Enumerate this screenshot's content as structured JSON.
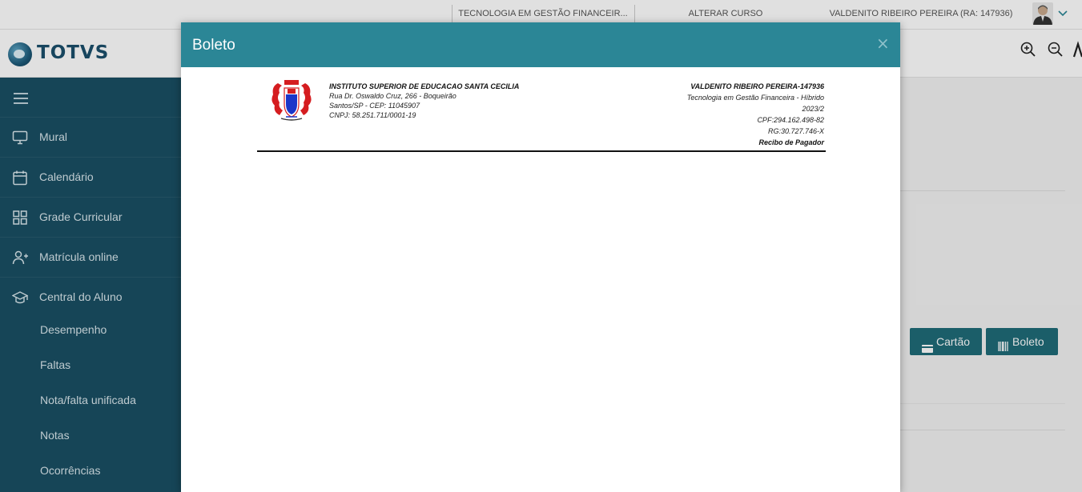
{
  "topbar": {
    "course": "TECNOLOGIA EM GESTÃO FINANCEIR...",
    "change_course": "ALTERAR CURSO",
    "user": "VALDENITO RIBEIRO PEREIRA (RA: 147936)"
  },
  "brand": {
    "logo_text": "TOTVS"
  },
  "sidebar": {
    "items": [
      {
        "label": "Mural",
        "icon": "monitor-icon"
      },
      {
        "label": "Calendário",
        "icon": "calendar-icon"
      },
      {
        "label": "Grade Curricular",
        "icon": "grid-icon"
      },
      {
        "label": "Matrícula online",
        "icon": "user-plus-icon"
      },
      {
        "label": "Central do Aluno",
        "icon": "graduation-cap-icon"
      }
    ],
    "subitems": [
      "Desempenho",
      "Faltas",
      "Nota/falta unificada",
      "Notas",
      "Ocorrências"
    ]
  },
  "background": {
    "card_button": "Cartão",
    "boleto_button": "Boleto"
  },
  "modal": {
    "title": "Boleto",
    "close": "×",
    "institution": {
      "name": "INSTITUTO SUPERIOR  DE EDUCACAO SANTA CECILIA",
      "address": "Rua Dr. Oswaldo Cruz, 266 - Boqueirão",
      "city": "Santos/SP - CEP: 11045907",
      "cnpj": "CNPJ: 58.251.711/0001-19"
    },
    "student": {
      "name": "VALDENITO RIBEIRO PEREIRA-147936",
      "course": "Tecnologia em Gestão Financeira - Híbrido",
      "period": "2023/2",
      "cpf": "CPF:294.162.498-82",
      "rg": "RG:30.727.746-X",
      "doc_type": "Recibo de Pagador"
    }
  },
  "colors": {
    "sidebar": "#1a4f63",
    "modal_header": "#2b8696",
    "button": "#1f6b78"
  }
}
